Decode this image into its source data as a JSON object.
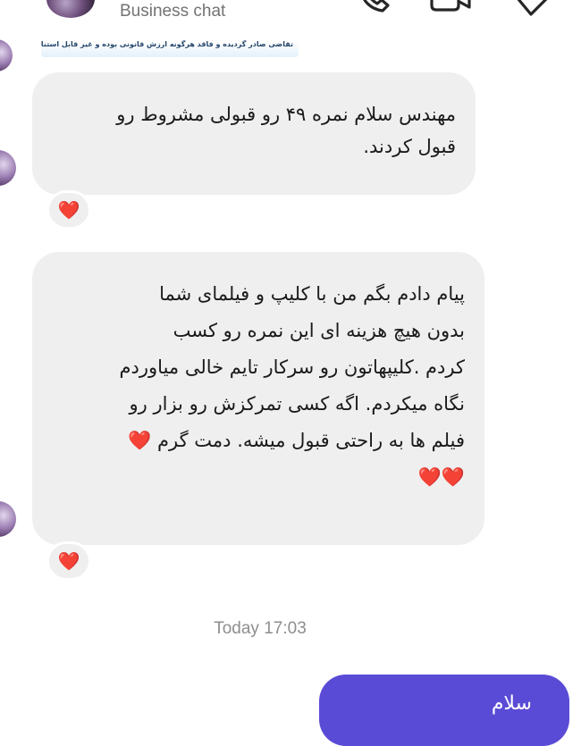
{
  "header": {
    "subtitle": "Business chat"
  },
  "messages": [
    {
      "image_caption": "تقاضی صادر گردیده و فاقد هرگونه ارزش قانونی بوده و غیر قابل استناد است"
    },
    {
      "text": "مهندس سلام نمره ۴۹ رو  قبولی مشروط رو\nقبول کردند.",
      "reaction": "❤️"
    },
    {
      "text": "پیام دادم بگم من با کلیپ و فیلمای شما\nبدون هیچ هزینه ای این نمره رو کسب\nکردم .کلیپهاتون رو سرکار تایم خالی میاوردم\nنگاه میکردم. اگه کسی تمرکزش رو بزار رو\nفیلم ها به راحتی قبول میشه. دمت گرم ❤️\n❤️❤️",
      "reaction": "❤️"
    }
  ],
  "timestamp": "Today 17:03",
  "outgoing": {
    "text": "سلام"
  },
  "colors": {
    "incoming_bubble": "#efefef",
    "outgoing_bubble": "#5a4bd6",
    "heart": "#e0242f"
  }
}
